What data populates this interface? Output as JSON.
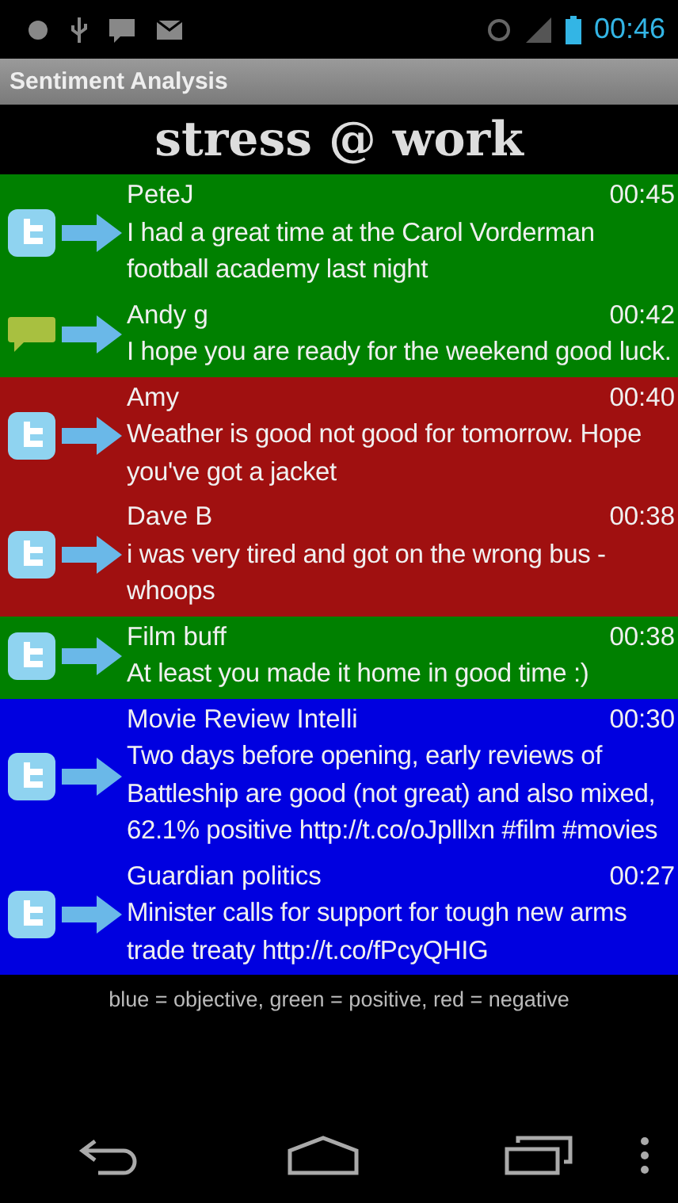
{
  "status_bar": {
    "time": "00:46"
  },
  "app_bar": {
    "title": "Sentiment Analysis"
  },
  "header": {
    "title": "stress @ work"
  },
  "messages": [
    {
      "kind": "tweet",
      "color": "#008000",
      "author": "PeteJ",
      "time": "00:45",
      "text": "I had a great time at the Carol Vorderman football academy last night"
    },
    {
      "kind": "message",
      "color": "#008000",
      "author": "Andy g",
      "time": "00:42",
      "text": "I hope you are ready for the weekend good luck."
    },
    {
      "kind": "tweet",
      "color": "#a01010",
      "author": "Amy",
      "time": "00:40",
      "text": "Weather is good not good for tomorrow. Hope you've got a jacket"
    },
    {
      "kind": "tweet",
      "color": "#a01010",
      "author": "Dave B",
      "time": "00:38",
      "text": "i was very tired and got on the wrong bus - whoops"
    },
    {
      "kind": "tweet",
      "color": "#008000",
      "author": "Film buff",
      "time": "00:38",
      "text": "At least you made it home in good time :)"
    },
    {
      "kind": "tweet",
      "color": "#0000e0",
      "author": "Movie Review Intelli",
      "time": "00:30",
      "text": "Two days before opening, early reviews of Battleship are good (not great) and also mixed, 62.1% positive http://t.co/oJplllxn #film #movies"
    },
    {
      "kind": "tweet",
      "color": "#0000e0",
      "author": "Guardian politics",
      "time": "00:27",
      "text": "Minister calls for support for tough new arms trade treaty http://t.co/fPcyQHIG"
    }
  ],
  "legend": "blue = objective, green = positive, red = negative"
}
